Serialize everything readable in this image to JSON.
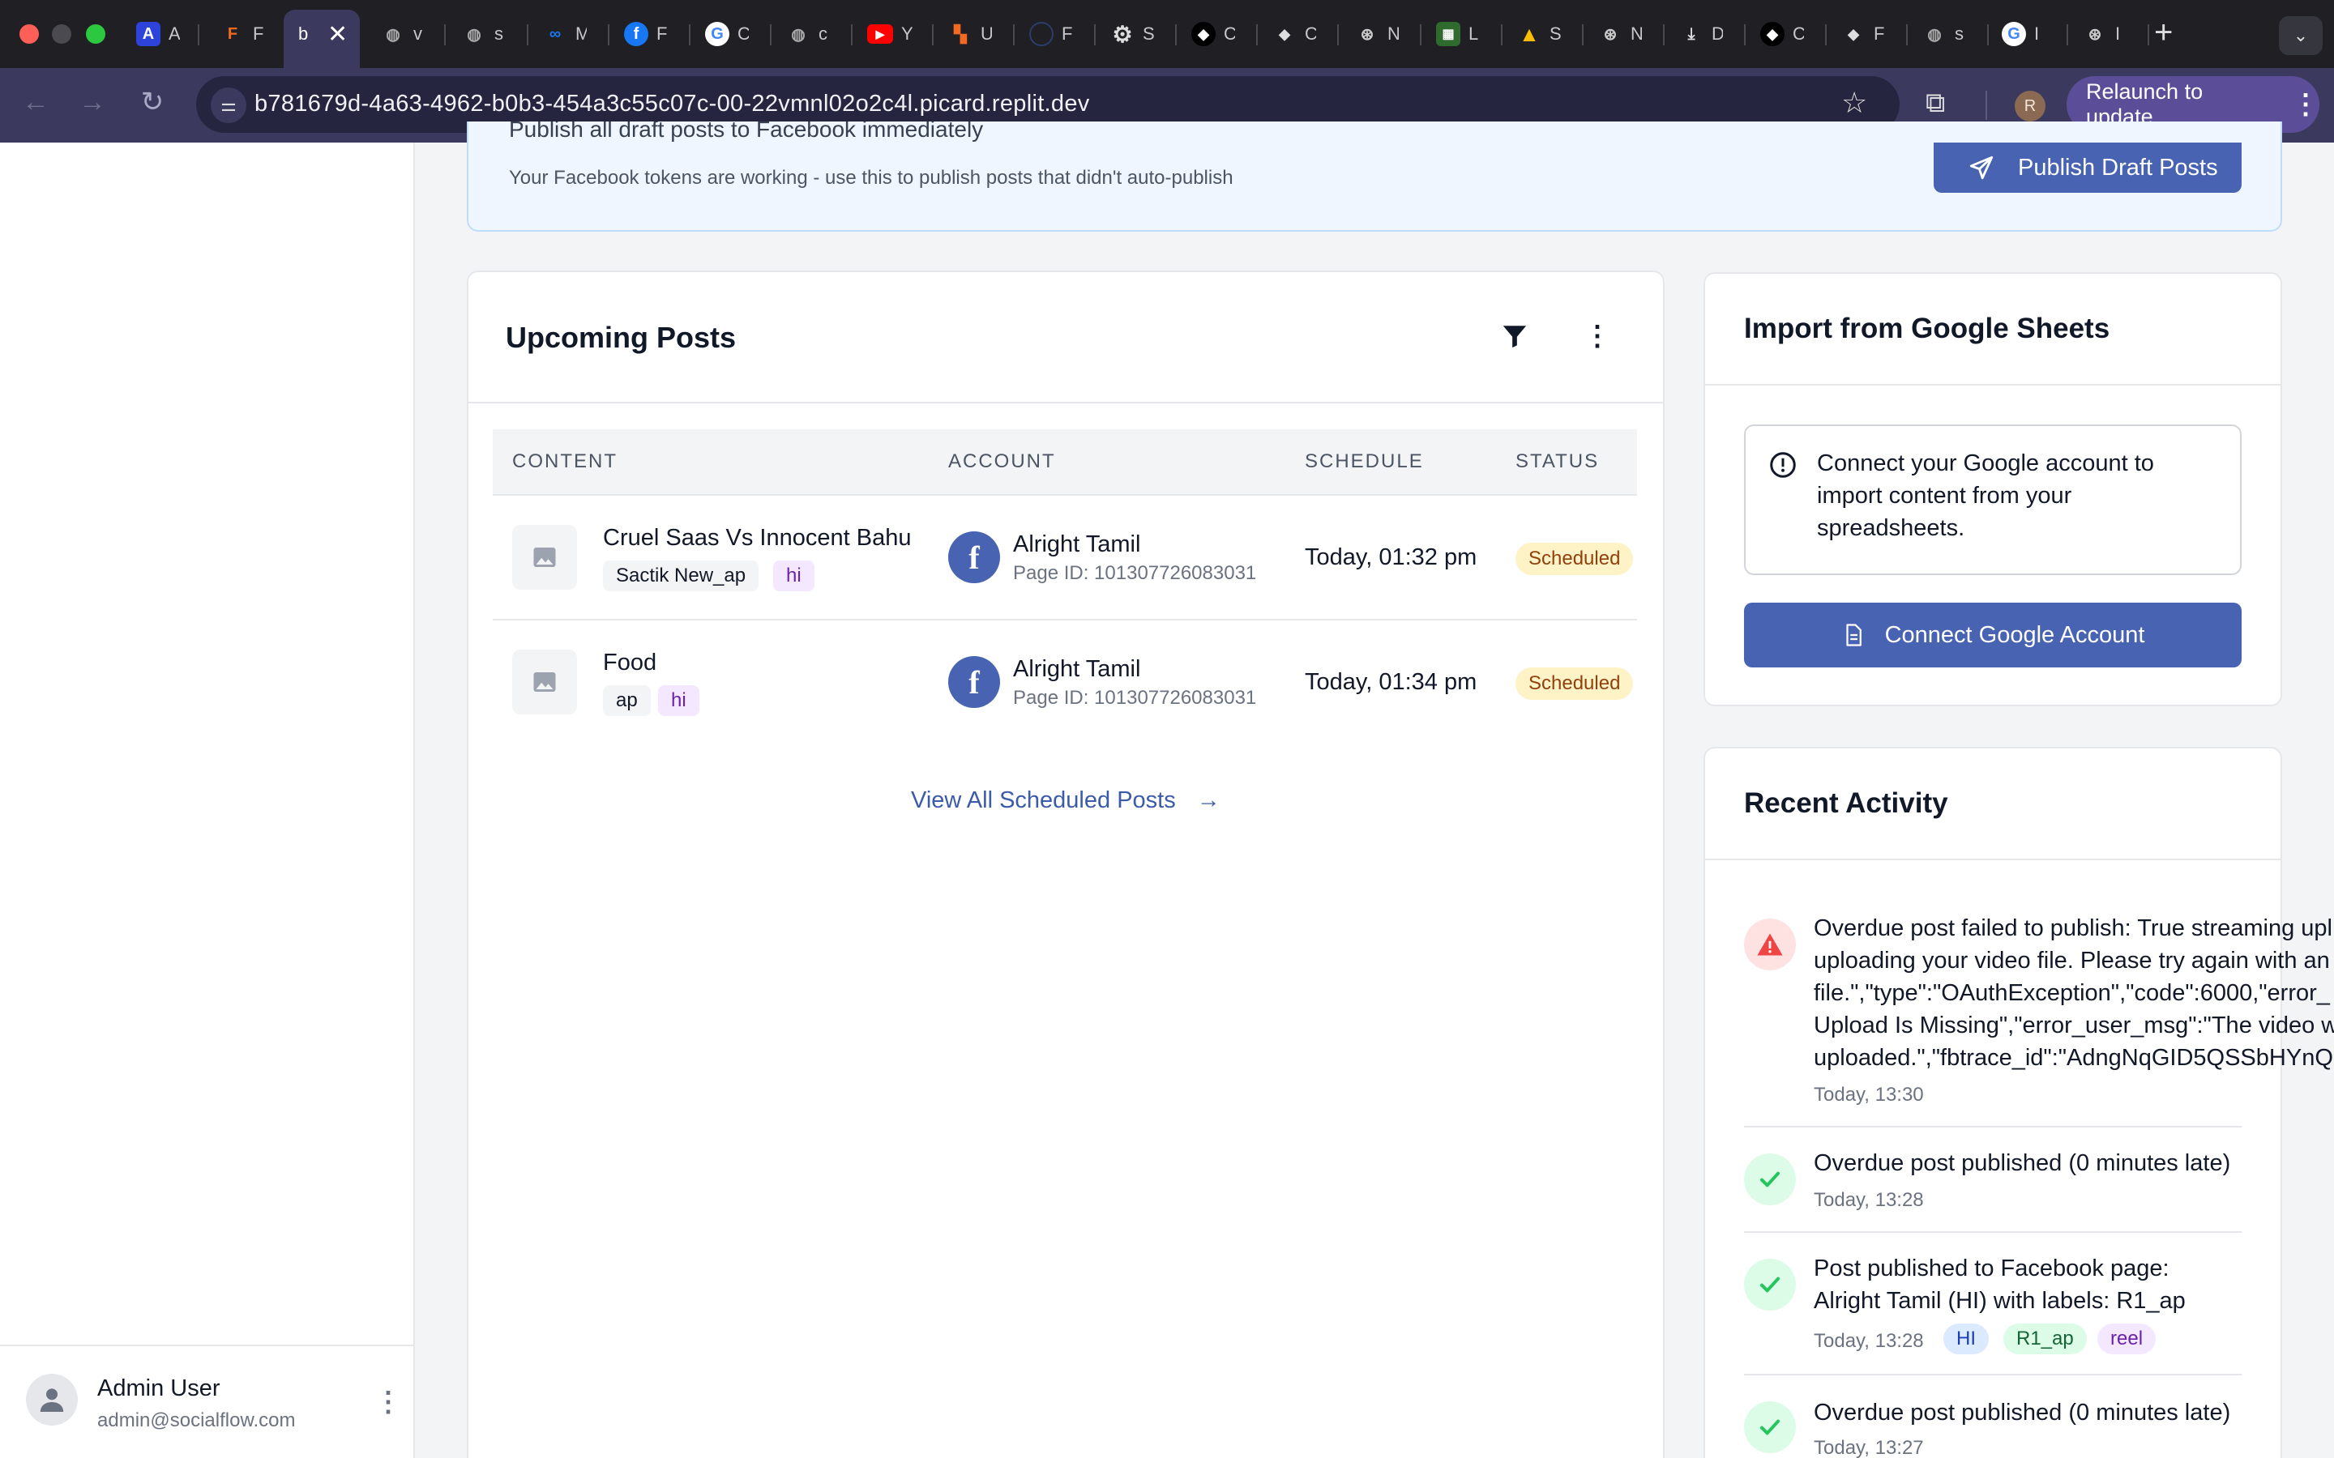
{
  "browser": {
    "url": "b781679d-4a63-4962-b0b3-454a3c55c07c-00-22vmnl02o2c4l.picard.replit.dev",
    "relaunch_label": "Relaunch to update",
    "profile_initial": "R",
    "tabs": [
      {
        "letter": "A",
        "label": "A"
      },
      {
        "letter": "F",
        "label": "F"
      },
      {
        "letter": "b",
        "label": "b"
      },
      {
        "letter": "v",
        "label": "v"
      },
      {
        "letter": "s",
        "label": "s"
      },
      {
        "letter": "M",
        "label": "M"
      },
      {
        "letter": "F",
        "label": "F"
      },
      {
        "letter": "C",
        "label": "C"
      },
      {
        "letter": "c",
        "label": "c"
      },
      {
        "letter": "Y",
        "label": "Y"
      },
      {
        "letter": "U",
        "label": "U"
      },
      {
        "letter": "F",
        "label": "F"
      },
      {
        "letter": "S",
        "label": "S"
      },
      {
        "letter": "C",
        "label": "C"
      },
      {
        "letter": "C",
        "label": "C"
      },
      {
        "letter": "N",
        "label": "N"
      },
      {
        "letter": "L",
        "label": "L"
      },
      {
        "letter": "S",
        "label": "S"
      },
      {
        "letter": "N",
        "label": "N"
      },
      {
        "letter": "D",
        "label": "D"
      },
      {
        "letter": "C",
        "label": "C"
      },
      {
        "letter": "F",
        "label": "F"
      },
      {
        "letter": "s",
        "label": "s"
      },
      {
        "letter": "I",
        "label": "I"
      },
      {
        "letter": "I",
        "label": "I"
      }
    ]
  },
  "sidebar": {
    "user_name": "Admin User",
    "user_email": "admin@socialflow.com"
  },
  "banner": {
    "title": "Publish all draft posts to Facebook immediately",
    "description": "Your Facebook tokens are working - use this to publish posts that didn't auto-publish",
    "button_label": "Publish Draft Posts"
  },
  "upcoming": {
    "title": "Upcoming Posts",
    "columns": [
      "CONTENT",
      "ACCOUNT",
      "SCHEDULE",
      "STATUS"
    ],
    "rows": [
      {
        "title": "Cruel Saas Vs Innocent Bahu",
        "tag1": "Sactik New_ap",
        "tag2": "hi",
        "account": "Alright Tamil",
        "page_id": "Page ID: 101307726083031",
        "schedule": "Today, 01:32 pm",
        "status": "Scheduled"
      },
      {
        "title": "Food",
        "tag1": "ap",
        "tag2": "hi",
        "account": "Alright Tamil",
        "page_id": "Page ID: 101307726083031",
        "schedule": "Today, 01:34 pm",
        "status": "Scheduled"
      }
    ],
    "view_all_label": "View All Scheduled Posts"
  },
  "google": {
    "title": "Import from Google Sheets",
    "info": "Connect your Google account to import content from your spreadsheets.",
    "button_label": "Connect Google Account"
  },
  "activity": {
    "title": "Recent Activity",
    "items": [
      {
        "lines": [
          "Overdue post failed to publish: True streaming upl",
          "uploading your video file. Please try again with an",
          "file.\",\"type\":\"OAuthException\",\"code\":6000,\"error_",
          "Upload Is Missing\",\"error_user_msg\":\"The video w",
          "uploaded.\",\"fbtrace_id\":\"AdngNqGID5QSSbHYnQ"
        ],
        "time": "Today, 13:30"
      },
      {
        "lines": [
          "Overdue post published (0 minutes late)"
        ],
        "time": "Today, 13:28"
      },
      {
        "lines": [
          "Post published to Facebook page:",
          "Alright Tamil (HI) with labels: R1_ap"
        ],
        "time": "Today, 13:28",
        "labels": [
          "HI",
          "R1_ap",
          "reel"
        ]
      },
      {
        "lines": [
          "Overdue post published (0 minutes late)"
        ],
        "time": "Today, 13:27"
      }
    ]
  },
  "colors": {
    "primary_button": "#4863b1",
    "scheduled_badge_bg": "#fef3c7",
    "banner_bg": "#eff6ff",
    "error_icon": "#ef4444",
    "success_icon": "#22c55e"
  }
}
